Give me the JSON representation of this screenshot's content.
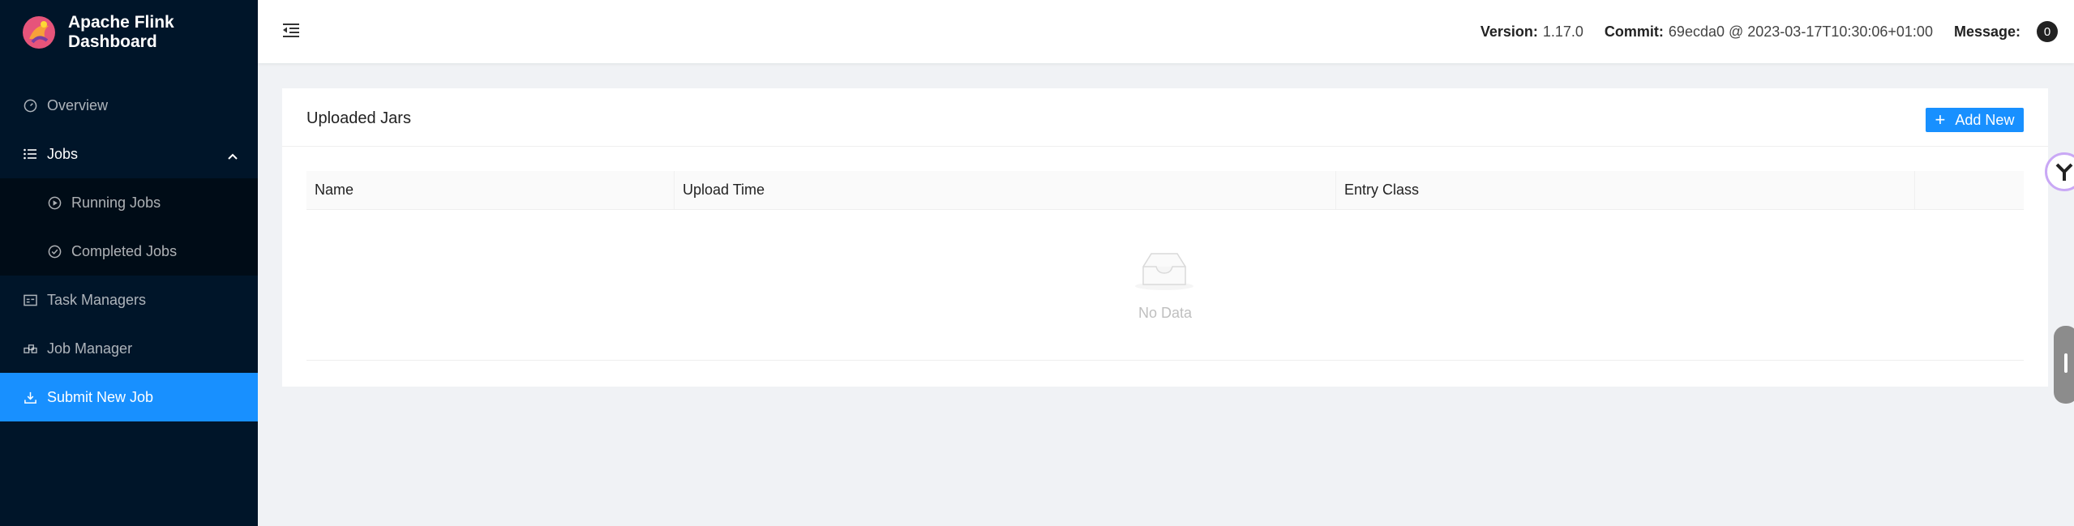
{
  "app": {
    "title": "Apache Flink Dashboard"
  },
  "sidebar": {
    "items": [
      {
        "label": "Overview",
        "icon": "dashboard-icon"
      },
      {
        "label": "Jobs",
        "icon": "list-icon"
      },
      {
        "label": "Running Jobs",
        "icon": "play-circle-icon"
      },
      {
        "label": "Completed Jobs",
        "icon": "check-circle-icon"
      },
      {
        "label": "Task Managers",
        "icon": "schedule-icon"
      },
      {
        "label": "Job Manager",
        "icon": "cluster-icon"
      },
      {
        "label": "Submit New Job",
        "icon": "upload-icon"
      }
    ]
  },
  "header": {
    "version_label": "Version:",
    "version": "1.17.0",
    "commit_label": "Commit:",
    "commit": "69ecda0 @ 2023-03-17T10:30:06+01:00",
    "message_label": "Message:",
    "message_count": "0"
  },
  "card": {
    "title": "Uploaded Jars",
    "add_button": "Add New",
    "table": {
      "columns": [
        "Name",
        "Upload Time",
        "Entry Class",
        ""
      ],
      "empty_text": "No Data"
    }
  },
  "colors": {
    "sidebar": "#001529",
    "accent": "#1890ff",
    "background": "#f0f2f5"
  }
}
